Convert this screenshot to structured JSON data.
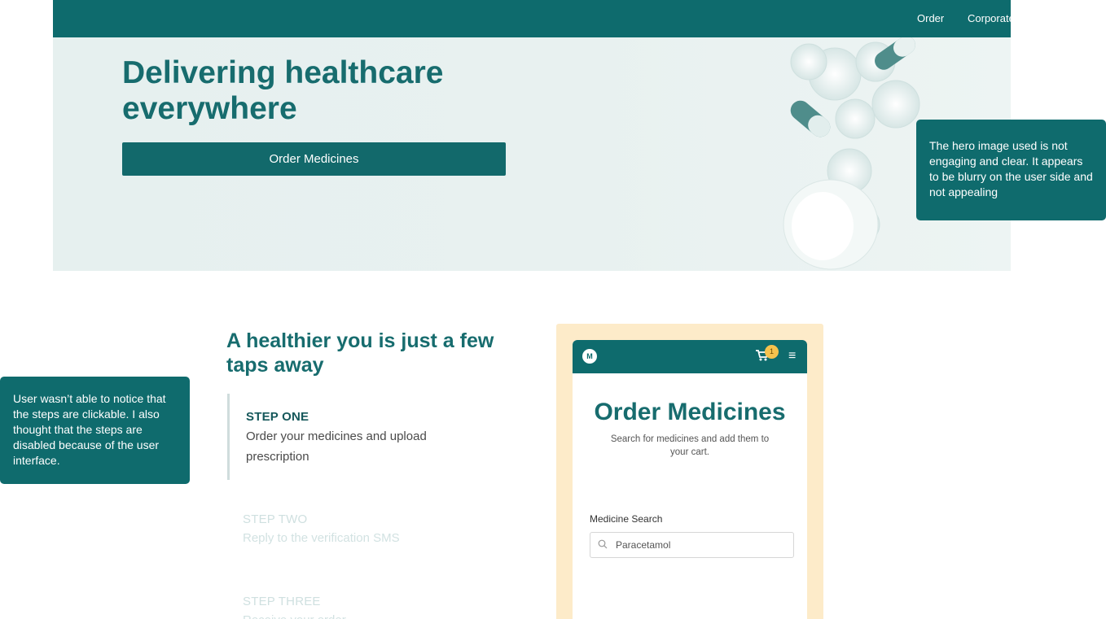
{
  "nav": {
    "items": [
      "Order",
      "Corporate"
    ]
  },
  "hero": {
    "title": "Delivering healthcare everywhere",
    "cta_label": "Order Medicines"
  },
  "annotations": {
    "hero_note": "The hero image used is not engaging and clear. It appears to be blurry on the user side and not appealing",
    "steps_note": "User wasn’t able to notice that the steps are clickable. I also thought that the steps are disabled because of the user interface."
  },
  "steps_section": {
    "title": "A healthier you is just a few taps away",
    "steps": [
      {
        "label": "STEP ONE",
        "desc": "Order your medicines and upload prescription",
        "active": true
      },
      {
        "label": "STEP TWO",
        "desc": "Reply to the verification SMS",
        "active": false
      },
      {
        "label": "STEP THREE",
        "desc": "Receive your order",
        "active": false
      }
    ]
  },
  "phone": {
    "cart_count": "1",
    "title": "Order Medicines",
    "subtitle": "Search for medicines and add them to your cart.",
    "search_label": "Medicine Search",
    "search_value": "Paracetamol"
  },
  "colors": {
    "brand": "#0e6b6d",
    "mock_background": "#fdebc9",
    "badge": "#f5c24e"
  }
}
